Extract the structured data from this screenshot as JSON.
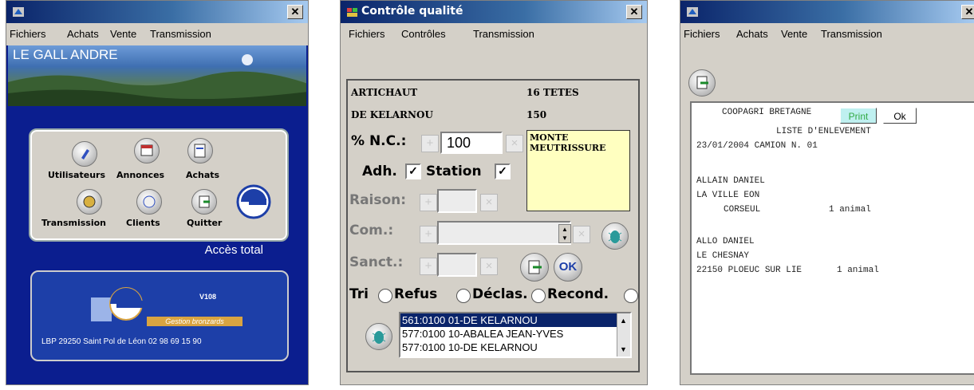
{
  "win1": {
    "menu": [
      "Fichiers",
      "Achats",
      "Vente",
      "Transmission"
    ],
    "banner_title": "LE GALL ANDRE",
    "buttons": [
      "Utilisateurs",
      "Annonces",
      "Achats",
      "Transmission",
      "Clients",
      "Quitter"
    ],
    "access": "Accès total",
    "version": "V108",
    "ribbon": "Gestion bronzards",
    "address": "LBP 29250 Saint Pol de Léon  02 98 69 15 90"
  },
  "win2": {
    "title": "Contrôle qualité",
    "menu": [
      "Fichiers",
      "Contrôles",
      "Transmission"
    ],
    "product": "ARTICHAUT",
    "quantity_label": "16 TETES",
    "origin": "DE KELARNOU",
    "count": "150",
    "nc_label": "% N.C.:",
    "nc_value": "100",
    "note": [
      "MONTE",
      "MEUTRISSURE"
    ],
    "adh_label": "Adh.",
    "station_label": "Station",
    "raison_label": "Raison:",
    "com_label": "Com.:",
    "sanct_label": "Sanct.:",
    "ok_label": "OK",
    "tri_label": "Tri",
    "radios": [
      "Refus",
      "Déclas.",
      "Recond."
    ],
    "list": [
      "561:0100 01-DE KELARNOU",
      "577:0100 10-ABALEA JEAN-YVES",
      "577:0100 10-DE KELARNOU"
    ]
  },
  "win3": {
    "menu": [
      "Fichiers",
      "Achats",
      "Vente",
      "Transmission"
    ],
    "company": "COOPAGRI BRETAGNE",
    "print_label": "Print",
    "ok_label": "Ok",
    "doc_title": "LISTE D'ENLEVEMENT",
    "date_line": "23/01/2004    CAMION N. 01",
    "entries": [
      {
        "name": "ALLAIN DANIEL",
        "addr": "LA VILLE EON",
        "city": "CORSEUL",
        "qty": "1 animal"
      },
      {
        "name": "ALLO DANIEL",
        "addr": "LE CHESNAY",
        "city": "22150  PLOEUC SUR LIE",
        "qty": "1 animal"
      }
    ]
  },
  "colors": {
    "titlebar": "#0a246a",
    "body_blue": "#0b1e8f",
    "note_yellow": "#ffffc0"
  }
}
